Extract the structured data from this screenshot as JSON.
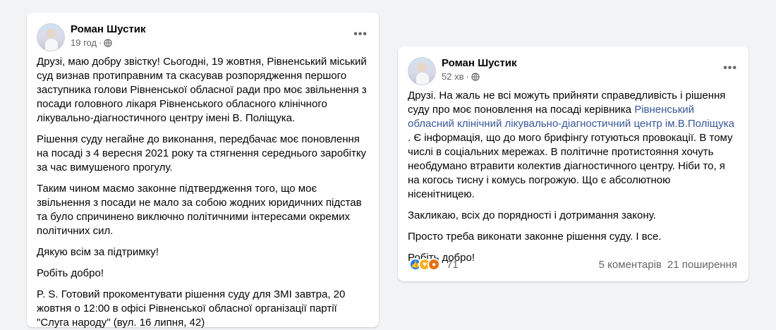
{
  "post1": {
    "author": "Роман Шустик",
    "time": "19 год",
    "paragraphs": [
      "Друзі, маю добру звістку! Сьогодні, 19 жовтня, Рівненський міський суд визнав протиправним та скасував розпорядження першого заступника голови Рівненської обласної ради  про моє звільнення з посади головного лікаря Рівненського обласного клінічного лікувально-діагностичного центру імені В. Поліщука.",
      " Рішення суду негайне до виконання, передбачає моє поновлення на посаді з 4 вересня 2021 року та стягнення середнього заробітку за час вимушеного прогулу.",
      "Таким чином маємо законне підтвердження того, що моє звільнення з посади не мало за собою жодних юридичних підстав та було спричинено виключно політичними інтересами окремих політичних сил.",
      "Дякую всім за підтримку!",
      "Робіть добро!",
      " P. S. Готовий прокоментувати рішення суду для ЗМІ завтра, 20 жовтня о 12:00 в офісі Рівненської обласної організації партії \"Слуга народу\" (вул. 16 липня, 42)"
    ]
  },
  "post2": {
    "author": "Роман Шустик",
    "time": "52 хв",
    "p1_before": "Друзі. На жаль не всі можуть прийняти справедливість і рішення суду про моє поновлення на посаді керівника ",
    "p1_link": "Рівненський обласний клінічний лікувально-діагностичний центр ім.В.Поліщука",
    "p1_after": " .  Є інформація, що до мого брифінгу готуються провокації. В тому числі в соціальних мережах. В політичне протистояння хочуть необдумано втравити колектив діагностичного центру. Ніби то, я на когось тисну і комусь погрожую. Що є абсолютною нісенітницею.",
    "p2": "Закликаю, всіх до порядності і дотримання закону.",
    "p3": "Просто треба виконати законне рішення суду. І все.",
    "p4": "Робіть добро!",
    "reaction_count": "71",
    "comments": "5 коментарів",
    "shares": "21 поширення",
    "reaction_icons": [
      "like-icon",
      "love-icon",
      "angry-icon"
    ]
  },
  "colors": {
    "link": "#385898",
    "meta": "#65676b",
    "like": "#1877f2"
  }
}
